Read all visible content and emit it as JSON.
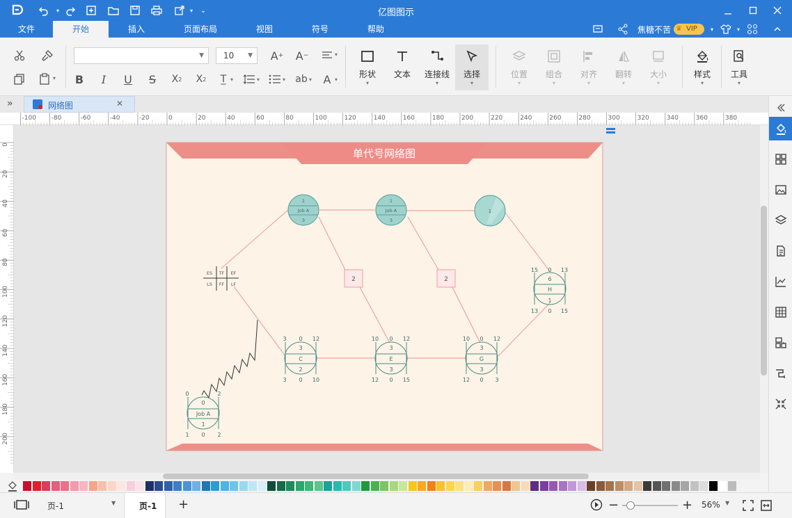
{
  "app": {
    "title": "亿图图示",
    "user": "焦糖不苦",
    "vip": "VIP"
  },
  "menu": [
    "文件",
    "开始",
    "插入",
    "页面布局",
    "视图",
    "符号",
    "帮助"
  ],
  "ribbon": {
    "font_size": "10",
    "buttons": {
      "shape": "形状",
      "text": "文本",
      "connector": "连接线",
      "select": "选择",
      "position": "位置",
      "group": "组合",
      "align": "对齐",
      "flip": "翻转",
      "size": "大小",
      "style": "样式",
      "tools": "工具"
    }
  },
  "doc_tab": "网络图",
  "ruler_h": [
    "-100",
    "-80",
    "-60",
    "-40",
    "-20",
    "0",
    "20",
    "40",
    "60",
    "80",
    "100",
    "120",
    "140",
    "160",
    "180",
    "200",
    "220",
    "240",
    "260",
    "280",
    "300",
    "320",
    "340",
    "360",
    "380"
  ],
  "ruler_v": [
    "0",
    "20",
    "40",
    "60",
    "80",
    "100",
    "120",
    "140",
    "160",
    "180",
    "200"
  ],
  "diagram": {
    "title": "单代号网络图",
    "legend": {
      "es": "ES",
      "tf": "TF",
      "ef": "EF",
      "ls": "LS",
      "ff": "FF",
      "lf": "LF"
    },
    "top_nodes": [
      {
        "top": "1",
        "mid": "Job A",
        "bot": "3"
      },
      {
        "top": "1",
        "mid": "Job A",
        "bot": "3"
      },
      {
        "label": "1"
      }
    ],
    "lags": [
      "2",
      "2"
    ],
    "node_h": {
      "tl": "15",
      "tc": "0",
      "tr": "13",
      "top": "6",
      "mid": "H",
      "bot": "1",
      "bl": "13",
      "bc": "0",
      "br": "15"
    },
    "node_c": {
      "tl": "3",
      "tc": "0",
      "tr": "12",
      "top": "3",
      "mid": "C",
      "bot": "2",
      "bl": "3",
      "bc": "0",
      "br": "10"
    },
    "node_e": {
      "tl": "10",
      "tc": "0",
      "tr": "12",
      "top": "3",
      "mid": "E",
      "bot": "3",
      "bl": "12",
      "bc": "0",
      "br": "15"
    },
    "node_g": {
      "tl": "10",
      "tc": "0",
      "tr": "12",
      "top": "3",
      "mid": "G",
      "bot": "3",
      "bl": "12",
      "bc": "0",
      "br": "3"
    },
    "node_a": {
      "tl": "0",
      "tc": "",
      "tr": "2",
      "top": "0",
      "mid": "Job A",
      "bot": "1",
      "bl": "1",
      "bc": "0",
      "br": "2"
    }
  },
  "status": {
    "page_sel": "页-1",
    "page_tab": "页-1",
    "zoom": "56%"
  },
  "palette": [
    "#c8102e",
    "#e0202c",
    "#d6405a",
    "#e0607e",
    "#ec7088",
    "#f39aac",
    "#f7b6c2",
    "#f7a48a",
    "#f9c0a8",
    "#fbd6c6",
    "#fde6e0",
    "#f8d0dc",
    "#fae2ea",
    "#1f2f6b",
    "#2a4b8d",
    "#2e62a8",
    "#3c7ec8",
    "#4a94d9",
    "#6fb0e6",
    "#1f77b4",
    "#2b9bd6",
    "#4cb4e6",
    "#6cc6ec",
    "#9ad8f0",
    "#bfe6f4",
    "#d8eef8",
    "#0f4d3a",
    "#166b4a",
    "#1f8a5a",
    "#2ea56c",
    "#3cb878",
    "#5cc48c",
    "#1aa39a",
    "#2bb8ae",
    "#4ccac0",
    "#7fd8d0",
    "#1f9a3a",
    "#46b44a",
    "#7cc464",
    "#a8d87c",
    "#c8e69c",
    "#f6c81e",
    "#f9a825",
    "#f57f17",
    "#fbc02d",
    "#ffd54f",
    "#ffe082",
    "#ffecb3",
    "#f7d060",
    "#f0a860",
    "#e89050",
    "#d87840",
    "#f2c490",
    "#f8dcb8",
    "#5c2d82",
    "#7b3f9e",
    "#9458b4",
    "#a874c6",
    "#c09ad8",
    "#d6bce6",
    "#6b3e26",
    "#8b5a3c",
    "#a8744e",
    "#c08c64",
    "#d4a880",
    "#e4c4a4",
    "#3a3a3a",
    "#555555",
    "#707070",
    "#8a8a8a",
    "#a6a6a6",
    "#c2c2c2",
    "#dcdcdc",
    "#000000",
    "#ffffff",
    "#bcbcbc"
  ]
}
